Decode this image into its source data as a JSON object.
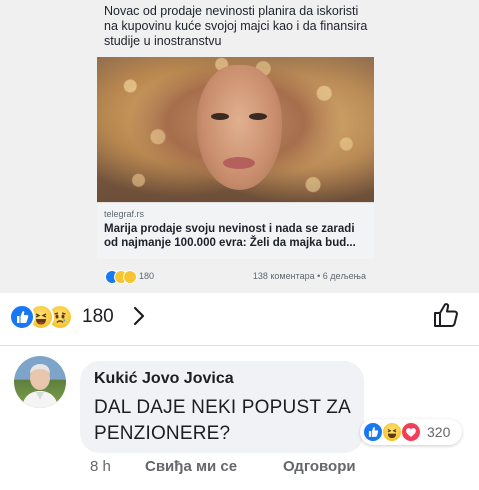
{
  "shared_post": {
    "caption": "Novac od prodaje nevinosti planira da iskoristi na kupovinu kuće svojoj majci kao i da finansira studije u inostranstvu",
    "link": {
      "domain": "telegraf.rs",
      "title": "Marija prodaje svoju nevinost i nada se zaradi od najmanje 100.000 evra: Želi da majka bud..."
    },
    "stats": {
      "reaction_count": "180",
      "meta": "138 коментара • 6 дељења"
    }
  },
  "reactions": {
    "types": [
      "like-icon",
      "haha-icon",
      "sad-icon"
    ],
    "count": "180"
  },
  "comment": {
    "author": "Kukić Jovo Jovica",
    "text": "DAL DAJE NEKI POPUST ZA PENZIONERE?",
    "reactions": {
      "types": [
        "like-icon",
        "haha-icon",
        "love-icon"
      ],
      "count": "320"
    },
    "time": "8 h",
    "like_label": "Свиђа ми се",
    "reply_label": "Одговори"
  },
  "colors": {
    "like_blue": "#1877f2",
    "love_red": "#f33e58",
    "haha_yellow": "#f7c531",
    "bubble_gray": "#f0f2f5",
    "meta_gray": "#65676b"
  }
}
